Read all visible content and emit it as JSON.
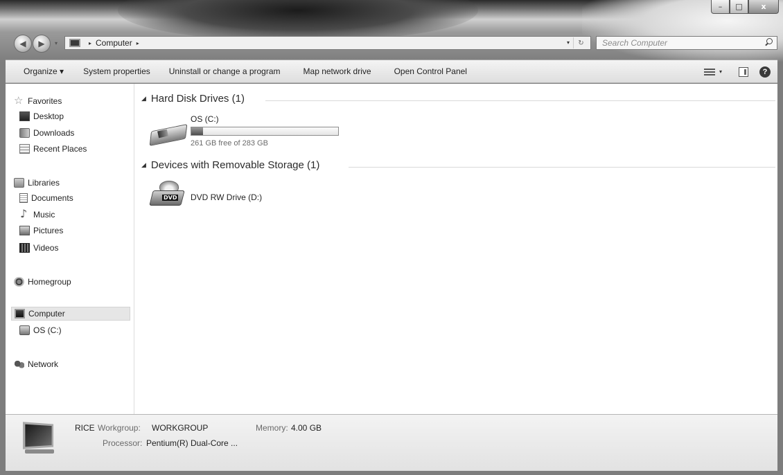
{
  "window": {
    "caption_buttons": {
      "minimize": "–",
      "maximize": "□",
      "close": "x"
    }
  },
  "address_bar": {
    "path": [
      "Computer"
    ],
    "separator": "▸",
    "search_placeholder": "Search Computer"
  },
  "toolbar": {
    "items": [
      "Organize ▾",
      "System properties",
      "Uninstall or change a program",
      "Map network drive",
      "Open Control Panel"
    ],
    "view_caret": "▾",
    "help": "?"
  },
  "navigation": {
    "favorites": {
      "label": "Favorites",
      "items": [
        "Desktop",
        "Downloads",
        "Recent Places"
      ]
    },
    "libraries": {
      "label": "Libraries",
      "items": [
        "Documents",
        "Music",
        "Pictures",
        "Videos"
      ]
    },
    "homegroup": "Homegroup",
    "computer": {
      "label": "Computer",
      "items": [
        "OS (C:)"
      ]
    },
    "network": "Network"
  },
  "content": {
    "groups": [
      {
        "title": "Hard Disk Drives (1)",
        "items": [
          {
            "name": "OS (C:)",
            "free_text": "261 GB free of 283 GB",
            "used_fraction": 0.078
          }
        ]
      },
      {
        "title": "Devices with Removable Storage (1)",
        "items": [
          {
            "name": "DVD RW Drive (D:)",
            "badge": "DVD"
          }
        ]
      }
    ]
  },
  "details": {
    "computer_name": "RICE",
    "workgroup_label": "Workgroup:",
    "workgroup_value": "WORKGROUP",
    "memory_label": "Memory:",
    "memory_value": "4.00 GB",
    "processor_label": "Processor:",
    "processor_value": "Pentium(R) Dual-Core ..."
  },
  "colors": {
    "selection": "#e6e6e6",
    "drive_bar_fill": "#6a6a6a",
    "secondary_text": "#6a6a6a"
  }
}
